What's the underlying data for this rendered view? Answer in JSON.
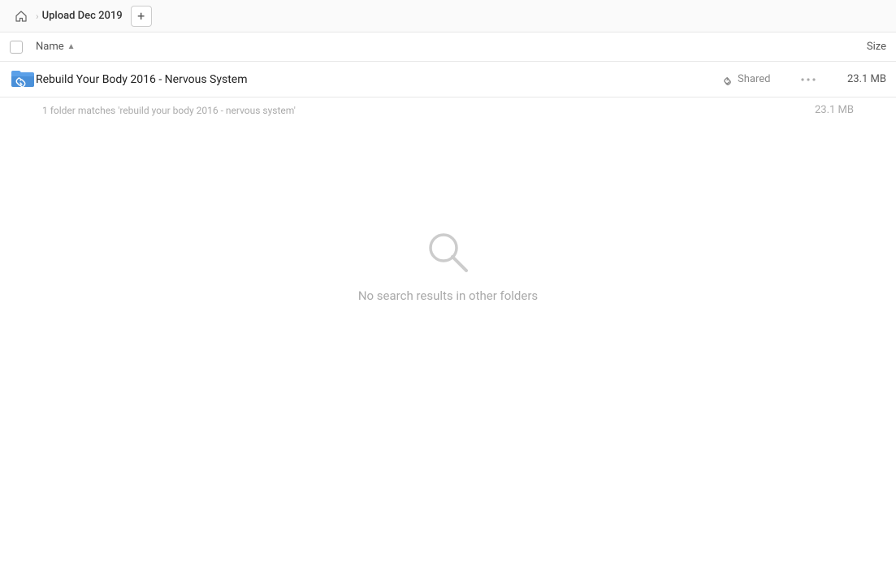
{
  "breadcrumb": {
    "home_icon": "🏠",
    "separator": "›",
    "title": "Upload Dec 2019",
    "add_btn_label": "+"
  },
  "columns": {
    "name_label": "Name",
    "sort_arrow": "▲",
    "size_label": "Size"
  },
  "file_row": {
    "name": "Rebuild Your Body 2016 - Nervous System",
    "shared_label": "Shared",
    "size": "23.1 MB",
    "more_icon": "•••"
  },
  "match_info": {
    "text": "1 folder matches 'rebuild your body 2016 - nervous system'",
    "size": "23.1 MB"
  },
  "empty_state": {
    "message": "No search results in other folders"
  }
}
